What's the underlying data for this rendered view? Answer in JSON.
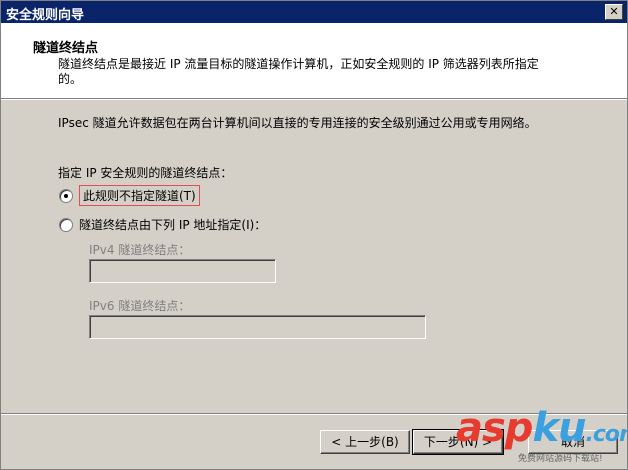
{
  "window": {
    "title": "安全规则向导",
    "close_glyph": "✕"
  },
  "header": {
    "title": "隧道终结点",
    "description": "隧道终结点是最接近 IP 流量目标的隧道操作计算机，正如安全规则的 IP 筛选器列表所指定的。"
  },
  "body": {
    "intro": "IPsec 隧道允许数据包在两台计算机间以直接的专用连接的安全级别通过公用或专用网络。",
    "group_label": "指定 IP 安全规则的隧道终结点：",
    "radio_no_tunnel": {
      "label": "此规则不指定隧道(T)",
      "checked": true
    },
    "radio_ip": {
      "label": "隧道终结点由下列 IP 地址指定(I)：",
      "checked": false
    },
    "ipv4_label": "IPv4 隧道终结点：",
    "ipv4_value": "",
    "ipv6_label": "IPv6 隧道终结点：",
    "ipv6_value": ""
  },
  "buttons": {
    "back": "< 上一步(B)",
    "next": "下一步(N) >",
    "cancel": "取消"
  },
  "watermark": {
    "main_a": "asp",
    "main_b": "ku",
    "dot": ".com",
    "sub": "免费网站源码下载站!"
  }
}
